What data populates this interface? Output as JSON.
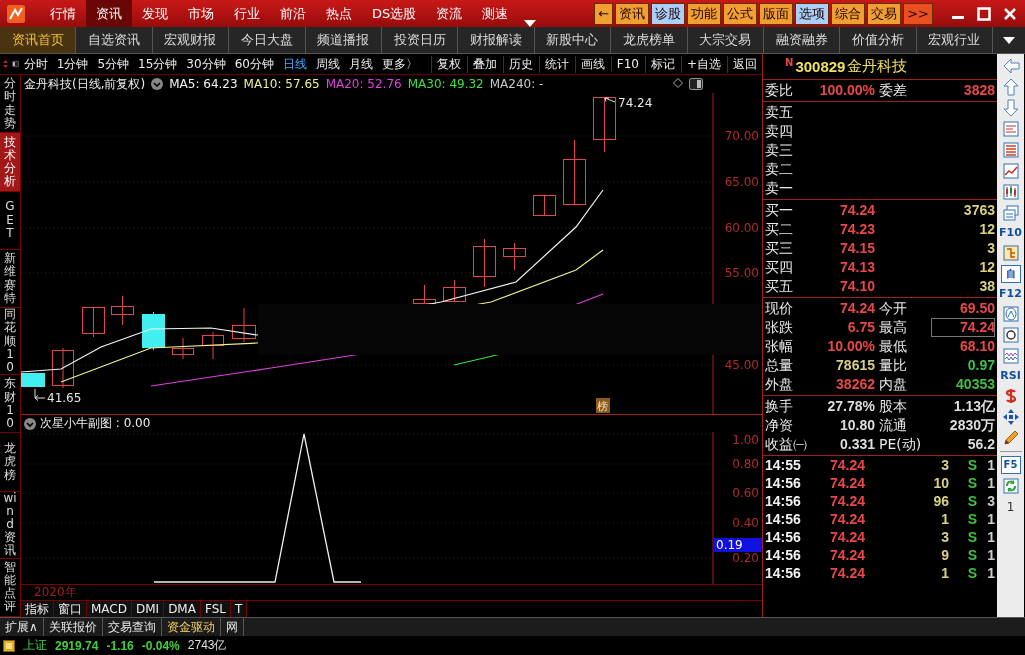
{
  "menu": [
    {
      "label": "行情",
      "selected": false
    },
    {
      "label": "资讯",
      "selected": true
    },
    {
      "label": "发现",
      "selected": false
    },
    {
      "label": "市场",
      "selected": false
    },
    {
      "label": "行业",
      "selected": false
    },
    {
      "label": "前沿",
      "selected": false
    },
    {
      "label": "热点",
      "selected": false
    },
    {
      "label": "DS选股",
      "selected": false
    },
    {
      "label": "资流",
      "selected": false
    },
    {
      "label": "测速",
      "selected": false
    }
  ],
  "quick_buttons": [
    {
      "label": "←",
      "color": "#f0a030"
    },
    {
      "label": "资讯",
      "color": "#f0a030"
    },
    {
      "label": "诊股",
      "color": "#a8d0f8"
    },
    {
      "label": "功能",
      "color": "#f0a030"
    },
    {
      "label": "公式",
      "color": "#f0a030"
    },
    {
      "label": "版面",
      "color": "#f0a030"
    },
    {
      "label": "选项",
      "color": "#a8d0f8"
    },
    {
      "label": "综合",
      "color": "#f0a030"
    },
    {
      "label": "交易",
      "color": "#f0a030"
    },
    {
      "label": ">>",
      "color": "#e85020"
    }
  ],
  "tabs": [
    {
      "label": "资讯首页",
      "selected": true
    },
    {
      "label": "自选资讯",
      "selected": false
    },
    {
      "label": "宏观财报",
      "selected": false
    },
    {
      "label": "今日大盘",
      "selected": false
    },
    {
      "label": "频道播报",
      "selected": false
    },
    {
      "label": "投资日历",
      "selected": false
    },
    {
      "label": "财报解读",
      "selected": false
    },
    {
      "label": "新股中心",
      "selected": false
    },
    {
      "label": "龙虎榜单",
      "selected": false
    },
    {
      "label": "大宗交易",
      "selected": false
    },
    {
      "label": "融资融券",
      "selected": false
    },
    {
      "label": "价值分析",
      "selected": false
    },
    {
      "label": "宏观行业",
      "selected": false
    }
  ],
  "periods": [
    {
      "label": "分时",
      "selected": false
    },
    {
      "label": "1分钟",
      "selected": false
    },
    {
      "label": "5分钟",
      "selected": false
    },
    {
      "label": "15分钟",
      "selected": false
    },
    {
      "label": "30分钟",
      "selected": false
    },
    {
      "label": "60分钟",
      "selected": false
    },
    {
      "label": "日线",
      "selected": true
    },
    {
      "label": "周线",
      "selected": false
    },
    {
      "label": "月线",
      "selected": false
    },
    {
      "label": "更多〉",
      "selected": false
    }
  ],
  "chart_tools": [
    "复权",
    "叠加",
    "历史",
    "统计",
    "画线",
    "F10",
    "标记",
    "+自选",
    "返回"
  ],
  "side_tabs": [
    {
      "label": "分时走势",
      "selected": false
    },
    {
      "label": "技术分析",
      "selected": true
    },
    {
      "label": "GET",
      "selected": false
    },
    {
      "label": "新维赛特",
      "selected": false
    },
    {
      "label": "同花顺10",
      "selected": false
    },
    {
      "label": "东财10",
      "selected": false
    },
    {
      "label": "龙虎榜",
      "selected": false
    },
    {
      "label": "wind资讯",
      "selected": false
    },
    {
      "label": "智能点评",
      "selected": false
    }
  ],
  "main_chart": {
    "title": "金丹科技(日线,前复权)",
    "moving_averages": [
      {
        "label": "MA5: 64.23",
        "color": "#f4f4f4"
      },
      {
        "label": "MA10: 57.65",
        "color": "#f0f090"
      },
      {
        "label": "MA20: 52.76",
        "color": "#e040e0"
      },
      {
        "label": "MA30: 49.32",
        "color": "#40e040"
      },
      {
        "label": "MA240: -",
        "color": "#c8c8c8"
      }
    ],
    "y_labels": [
      "70.00",
      "65.00",
      "60.00",
      "55.00",
      "45.00"
    ],
    "high": "74.24",
    "low": "41.65",
    "badge": "榜"
  },
  "sub_chart": {
    "title": "次星小牛副图 : 0.00",
    "y_labels": [
      "1.00",
      "0.80",
      "0.60",
      "0.40",
      "0.20"
    ],
    "current": "0.19",
    "year": "2020年"
  },
  "indicator_tabs": [
    "指标",
    "窗口",
    "MACD",
    "DMI",
    "DMA",
    "FSL",
    "T"
  ],
  "quote": {
    "flag": "N",
    "code": "300829",
    "name": "金丹科技",
    "ratio": [
      {
        "label": "委比",
        "value": "100.00%"
      },
      {
        "label": "委差",
        "value": "3828"
      }
    ],
    "sells": [
      "卖五",
      "卖四",
      "卖三",
      "卖二",
      "卖一"
    ],
    "buys": [
      {
        "label": "买一",
        "price": "74.24",
        "volume": "3763"
      },
      {
        "label": "买二",
        "price": "74.23",
        "volume": "12"
      },
      {
        "label": "买三",
        "price": "74.15",
        "volume": "3"
      },
      {
        "label": "买四",
        "price": "74.13",
        "volume": "12"
      },
      {
        "label": "买五",
        "price": "74.10",
        "volume": "38"
      }
    ],
    "stats": [
      {
        "label": "现价",
        "value": "74.24",
        "color": "#e84848",
        "boxed": false
      },
      {
        "label": "今开",
        "value": "69.50",
        "color": "#e84848",
        "boxed": false
      },
      {
        "label": "张跌",
        "value": "6.75",
        "color": "#e84848",
        "boxed": false
      },
      {
        "label": "最高",
        "value": "74.24",
        "color": "#e84848",
        "boxed": true
      },
      {
        "label": "张幅",
        "value": "10.00%",
        "color": "#e84848",
        "boxed": false
      },
      {
        "label": "最低",
        "value": "68.10",
        "color": "#e84848",
        "boxed": false
      },
      {
        "label": "总量",
        "value": "78615",
        "color": "#d8d080",
        "boxed": false
      },
      {
        "label": "量比",
        "value": "0.97",
        "color": "#40c040",
        "boxed": false
      },
      {
        "label": "外盘",
        "value": "38262",
        "color": "#e84848",
        "boxed": false
      },
      {
        "label": "内盘",
        "value": "40353",
        "color": "#40c040",
        "boxed": false
      }
    ],
    "fundamentals": [
      {
        "label": "换手",
        "value": "27.78%"
      },
      {
        "label": "股本",
        "value": "1.13亿"
      },
      {
        "label": "净资",
        "value": "10.80"
      },
      {
        "label": "流通",
        "value": "2830万"
      },
      {
        "label": "收益㈠",
        "value": "0.331"
      },
      {
        "label": "PE(动)",
        "value": "56.2"
      }
    ],
    "trades": [
      {
        "time": "14:55",
        "price": "74.24",
        "volume": "3",
        "side": "S",
        "count": "1"
      },
      {
        "time": "14:56",
        "price": "74.24",
        "volume": "10",
        "side": "S",
        "count": "1"
      },
      {
        "time": "14:56",
        "price": "74.24",
        "volume": "96",
        "side": "S",
        "count": "3"
      },
      {
        "time": "14:56",
        "price": "74.24",
        "volume": "1",
        "side": "S",
        "count": "1"
      },
      {
        "time": "14:56",
        "price": "74.24",
        "volume": "3",
        "side": "S",
        "count": "1"
      },
      {
        "time": "14:56",
        "price": "74.24",
        "volume": "9",
        "side": "S",
        "count": "1"
      },
      {
        "time": "14:56",
        "price": "74.24",
        "volume": "1",
        "side": "S",
        "count": "1"
      }
    ]
  },
  "tool_strip": [
    {
      "kind": "arrow-left"
    },
    {
      "kind": "arrow-up"
    },
    {
      "kind": "arrow-down"
    },
    {
      "kind": "report"
    },
    {
      "kind": "table"
    },
    {
      "kind": "line-chart"
    },
    {
      "kind": "candles"
    },
    {
      "kind": "cards"
    },
    {
      "kind": "text",
      "label": "F10"
    },
    {
      "kind": "tree"
    },
    {
      "kind": "text",
      "label": "自"
    },
    {
      "kind": "text",
      "label": "F12"
    },
    {
      "kind": "formula"
    },
    {
      "kind": "circle"
    },
    {
      "kind": "wave"
    },
    {
      "kind": "text",
      "label": "RSI"
    },
    {
      "kind": "dollar"
    },
    {
      "kind": "move"
    },
    {
      "kind": "pencil"
    },
    {
      "kind": "divider"
    },
    {
      "kind": "text",
      "label": "F5"
    },
    {
      "kind": "refresh"
    },
    {
      "kind": "plain",
      "label": "1"
    }
  ],
  "bottom_tabs": [
    {
      "label": "扩展∧",
      "highlighted": false
    },
    {
      "label": "关联报价",
      "highlighted": false
    },
    {
      "label": "交易查询",
      "highlighted": false
    },
    {
      "label": "资金驱动",
      "highlighted": true
    },
    {
      "label": "网",
      "highlighted": false
    }
  ],
  "index_bar": {
    "name": "上证",
    "value": "2919.74",
    "change": "-1.16",
    "percent": "-0.04%",
    "amount": "2743亿"
  }
}
